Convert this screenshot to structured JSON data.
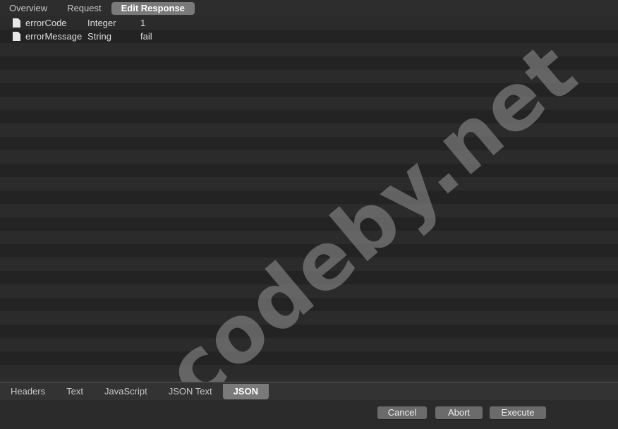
{
  "top_tabs": [
    {
      "label": "Overview"
    },
    {
      "label": "Request"
    },
    {
      "label": "Edit Response",
      "active": true
    }
  ],
  "rows": [
    {
      "icon": "document-icon",
      "name": "errorCode",
      "type": "Integer",
      "value": "1"
    },
    {
      "icon": "document-icon",
      "name": "errorMessage",
      "type": "String",
      "value": "fail"
    }
  ],
  "watermark": "codeby.net",
  "bottom_tabs": [
    {
      "label": "Headers"
    },
    {
      "label": "Text"
    },
    {
      "label": "JavaScript"
    },
    {
      "label": "JSON Text"
    },
    {
      "label": "JSON",
      "active": true
    }
  ],
  "buttons": {
    "cancel": "Cancel",
    "abort": "Abort",
    "execute": "Execute"
  }
}
